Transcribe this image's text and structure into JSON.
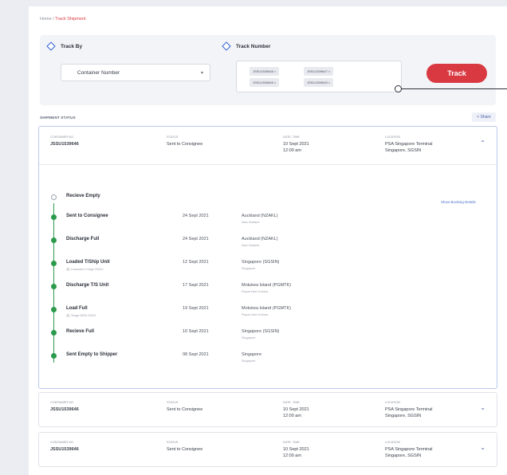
{
  "breadcrumb": {
    "home": "Home",
    "separator": " / ",
    "current": "Track Shipment"
  },
  "track_by": {
    "label": "Track By",
    "selected": "Container Number"
  },
  "track_number": {
    "label": "Track Number",
    "tags": [
      "JSSU1539646",
      "JSSU1539647",
      "JSSU1539646",
      "JSSU1539649"
    ]
  },
  "track_button": "Track",
  "shipment_status": {
    "title": "SHIPMENT STATUS",
    "share": "Share"
  },
  "columns": {
    "container": "CONTAINER NO.",
    "status": "STATUS",
    "datetime": "DATE, TIME",
    "location": "LOCATION"
  },
  "cards": [
    {
      "container": "JSSU1539646",
      "status": "Sent to Consignee",
      "date": "10 Sept 2021",
      "time": "12:00 am",
      "location_1": "PSA Singapore Terminal",
      "location_2": "Singapore, SGSIN"
    },
    {
      "container": "JSSU1539646",
      "status": "Sent to Consignee",
      "date": "10 Sept 2021",
      "time": "12:00 am",
      "location_1": "PSA Singapore Terminal",
      "location_2": "Singapore, SGSIN"
    },
    {
      "container": "JSSU1539646",
      "status": "Sent to Consignee",
      "date": "10 Sept 2021",
      "time": "12:00 am",
      "location_1": "PSA Singapore Terminal",
      "location_2": "Singapore, SGSIN"
    }
  ],
  "booking_link": "Show Booking Details",
  "events": [
    {
      "name": "Recieve Empty",
      "sub": "",
      "date": "",
      "place": "",
      "country": "",
      "done": false
    },
    {
      "name": "Sent to Consignee",
      "sub": "",
      "date": "24 Sept 2021",
      "place": "Auckland (NZAKL)",
      "country": "New Zealand",
      "done": true
    },
    {
      "name": "Discharge Full",
      "sub": "",
      "date": "24 Sept 2021",
      "place": "Auckland (NZAKL)",
      "country": "New Zealand",
      "done": true
    },
    {
      "name": "Loaded T/Ship Unit",
      "sub": "Lissamen's Hoge 22810",
      "date": "12 Sept 2021",
      "place": "Singapore (SGSIN)",
      "country": "Singapore",
      "done": true
    },
    {
      "name": "Discharge T/S Unit",
      "sub": "",
      "date": "17 Sept 2021",
      "place": "Motukea Island (PGMTK)",
      "country": "Papua New Guinea",
      "done": true
    },
    {
      "name": "Load Full",
      "sub": "Tenga 0505 22810",
      "date": "19 Sept 2021",
      "place": "Motukea Island (PGMTK)",
      "country": "Papua New Guinea",
      "done": true
    },
    {
      "name": "Recieve Full",
      "sub": "",
      "date": "10 Sept 2021",
      "place": "Singapore (SGSIN)",
      "country": "Singapore",
      "done": true
    },
    {
      "name": "Sent Empty to Shipper",
      "sub": "",
      "date": "08 Sept 2021",
      "place": "Singapore",
      "country": "Singapore",
      "done": true
    }
  ],
  "colors": {
    "accent": "#d93a42",
    "primary": "#2d5fd3",
    "success": "#2c9a4c"
  }
}
